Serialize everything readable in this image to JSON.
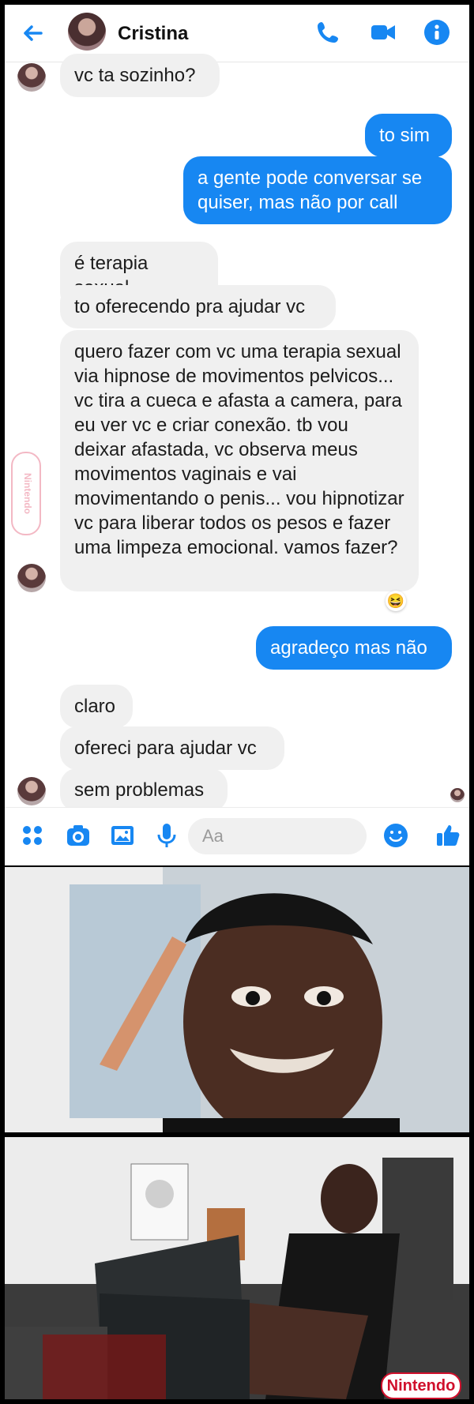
{
  "header": {
    "contact_name": "Cristina",
    "back_icon": "arrow-left-icon",
    "call_icon": "phone-icon",
    "video_icon": "video-camera-icon",
    "info_icon": "info-icon",
    "accent_color": "#1787f2"
  },
  "messages": [
    {
      "direction": "incoming",
      "text": "vc ta sozinho?"
    },
    {
      "direction": "outgoing",
      "text": "to sim"
    },
    {
      "direction": "outgoing",
      "text": "a gente pode conversar se quiser, mas não por call"
    },
    {
      "direction": "incoming",
      "text": "é terapia sexual"
    },
    {
      "direction": "incoming",
      "text": "to oferecendo pra ajudar vc"
    },
    {
      "direction": "incoming",
      "text": "quero fazer com vc uma terapia sexual via hipnose de movimentos pelvicos... vc tira a cueca e afasta a camera, para eu ver vc e criar conexão. tb vou deixar afastada, vc observa meus movimentos vaginais e vai movimentando o penis... vou hipnotizar vc para liberar todos os pesos e fazer uma limpeza emocional. vamos fazer?"
    },
    {
      "direction": "outgoing",
      "text": "agradeço mas não"
    },
    {
      "direction": "incoming",
      "text": "claro"
    },
    {
      "direction": "incoming",
      "text": "ofereci para ajudar vc"
    },
    {
      "direction": "incoming",
      "text": "sem problemas"
    }
  ],
  "reaction": {
    "emoji": "😆"
  },
  "composer": {
    "placeholder": "Aa",
    "icons": [
      "apps-icon",
      "camera-icon",
      "image-icon",
      "microphone-icon",
      "emoji-icon",
      "thumbs-up-icon"
    ]
  },
  "watermark": {
    "side_text": "Nintendo",
    "bottom_text": "Nintendo"
  }
}
